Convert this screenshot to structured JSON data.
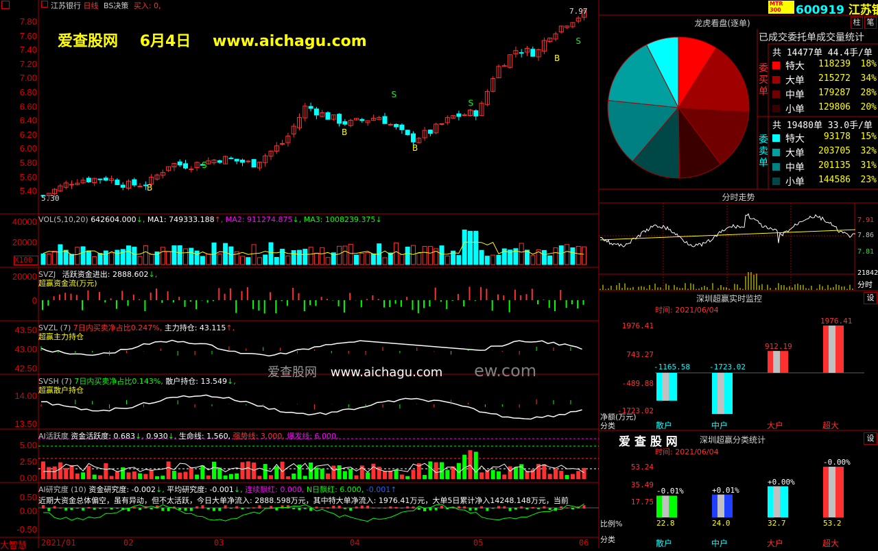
{
  "header": {
    "stock_name": "江苏银行",
    "period": "日线",
    "strategy": "BS决策",
    "buy_text": "买入: 0,",
    "code": "600919",
    "name_short": "江苏银",
    "badge_line1": "MTR",
    "badge_line2": "300"
  },
  "watermark": {
    "site": "爱查股网",
    "date": "6月4日",
    "url": "www.aichagu.com",
    "center_site": "爱查股网",
    "center_url": "www.aichagu.com",
    "center_tail": "ew.com"
  },
  "price_panel": {
    "y_labels": [
      "7.80",
      "7.60",
      "7.40",
      "7.20",
      "7.00",
      "6.80",
      "6.60",
      "6.40",
      "6.20",
      "6.00",
      "5.80",
      "5.60",
      "5.40"
    ],
    "high_label": "7.97",
    "low_label": "5.30",
    "s_label": "S",
    "b_label": "B"
  },
  "vol_panel": {
    "title": "VOL(5,10,20)",
    "vol": "642604.000",
    "ma1": "MA1: 749333.188",
    "ma2": "MA2: 911274.875",
    "ma3": "MA3: 1008239.375",
    "y_labels": [
      "40000",
      "20000"
    ],
    "unit": "X100"
  },
  "svzj_panel": {
    "title": "SVZJ",
    "label": "活跃资金进出: 2888.602",
    "sub": "超赢资金流(万元)",
    "y_labels": [
      "20000",
      "0"
    ]
  },
  "svzl_panel": {
    "title": "SVZL (7)",
    "ratio_label": "7日内买卖净占比",
    "ratio": "0.247%",
    "hold": "主力持仓: 43.115",
    "sub": "超赢主力持仓",
    "y_labels": [
      "43.50",
      "43.00",
      "42.50"
    ]
  },
  "svsh_panel": {
    "title": "SVSH (7)",
    "ratio_label": "7日内买卖净占比",
    "ratio": "0.143%",
    "hold": "散户持仓: 13.549",
    "sub": "超赢散户持仓",
    "y_labels": [
      "14.00",
      "13.50"
    ]
  },
  "ai_panel": {
    "title": "AI活跃度",
    "a": "资金活跃度: 0.683",
    "b": "0.930",
    "c": "生命线: 1.560",
    "d": "强势线: 3.000",
    "e": "爆发线: 6.000",
    "y_labels": [
      "5.00",
      "2.50",
      "0.00"
    ]
  },
  "research_panel": {
    "title": "AI研究度 (10)",
    "a": "资金研究度: -0.002",
    "b": "平均研究度: -0.001",
    "c": "连续飘红: 0.000",
    "d": "N日飘红: 6.000",
    "e": "-0.001",
    "note": "近期大资金总体偏空，虽有异动，但不太活跃，今日大单净流入: 2888.598万元，其中特大单净流入: 1976.41万元，大单5日累计净入14248.148万元，当前",
    "y_labels": [
      "0.50",
      "0.00",
      "-0.50"
    ]
  },
  "x_axis": {
    "labels": [
      "2021/01",
      "02",
      "03",
      "04",
      "05",
      "06"
    ],
    "corner": "大智慧"
  },
  "dragon": {
    "title": "龙虎看盘(逐单)",
    "btn1": "柱",
    "btn2": "笔",
    "stat_title": "已成交委托单成交量统计",
    "buy_side": "委买单",
    "sell_side": "委卖单",
    "buy_total": "共 14477单 44.4手/单",
    "sell_total": "共 19480单 33.0手/单",
    "buy_rows": [
      {
        "label": "特大",
        "value": "118239",
        "pct": "18%",
        "color": "#ff0000"
      },
      {
        "label": "大单",
        "value": "215272",
        "pct": "34%",
        "color": "#a00000"
      },
      {
        "label": "中单",
        "value": "179287",
        "pct": "28%",
        "color": "#700000"
      },
      {
        "label": "小单",
        "value": "129806",
        "pct": "20%",
        "color": "#3a0000"
      }
    ],
    "sell_rows": [
      {
        "label": "特大",
        "value": "93178",
        "pct": "15%",
        "color": "#00ffff"
      },
      {
        "label": "大单",
        "value": "203705",
        "pct": "32%",
        "color": "#00a0a0"
      },
      {
        "label": "中单",
        "value": "201135",
        "pct": "31%",
        "color": "#008080"
      },
      {
        "label": "小单",
        "value": "144586",
        "pct": "23%",
        "color": "#004848"
      }
    ]
  },
  "intraday": {
    "title": "分时走势",
    "p1": "7.91",
    "p2": "7.86",
    "p3": "7.81",
    "vol": "21842",
    "vol_unit": "分时"
  },
  "monitor": {
    "title": "深圳超赢实时监控",
    "btn": "设",
    "time": "时间: 2021/06/04",
    "y_labels": [
      "1976.41",
      "743.27",
      "-489.88",
      "-1723.02"
    ],
    "y_unit": "净额(万元)",
    "x_unit": "分类",
    "bars": [
      {
        "cat": "散户",
        "value": -1165.58,
        "label": "-1165.58"
      },
      {
        "cat": "中户",
        "value": -1723.02,
        "label": "-1723.02"
      },
      {
        "cat": "大户",
        "value": 912.19,
        "label": "912.19"
      },
      {
        "cat": "超大",
        "value": 1976.41,
        "label": "1976.41"
      }
    ]
  },
  "classify": {
    "logo": "爱 查 股 网",
    "title": "深圳超赢分类统计",
    "btn": "设",
    "time": "时间: 2021/06/04",
    "y_labels": [
      "53.24",
      "35.49",
      "17.75"
    ],
    "y_unit": "比例%",
    "x_unit": "分类",
    "bars": [
      {
        "cat": "散户",
        "value": 22.8,
        "label": "22.8",
        "chg": "-0.01%"
      },
      {
        "cat": "中户",
        "value": 24.0,
        "label": "24.0",
        "chg": "+0.01%"
      },
      {
        "cat": "大户",
        "value": 32.7,
        "label": "32.7",
        "chg": "+0.00%"
      },
      {
        "cat": "超大",
        "value": 53.2,
        "label": "53.2",
        "chg": "-0.00%"
      }
    ]
  },
  "colors": {
    "up": "#ff3030",
    "down": "#00ffff",
    "frame": "#a00000",
    "yellow": "#ffff00",
    "magenta": "#ff00ff",
    "green": "#00ff00"
  },
  "chart_data": {
    "type": "candlestick",
    "period": "2021/01 - 2021/06",
    "price_range": [
      5.3,
      7.97
    ],
    "volume_range": [
      0,
      40000
    ]
  }
}
